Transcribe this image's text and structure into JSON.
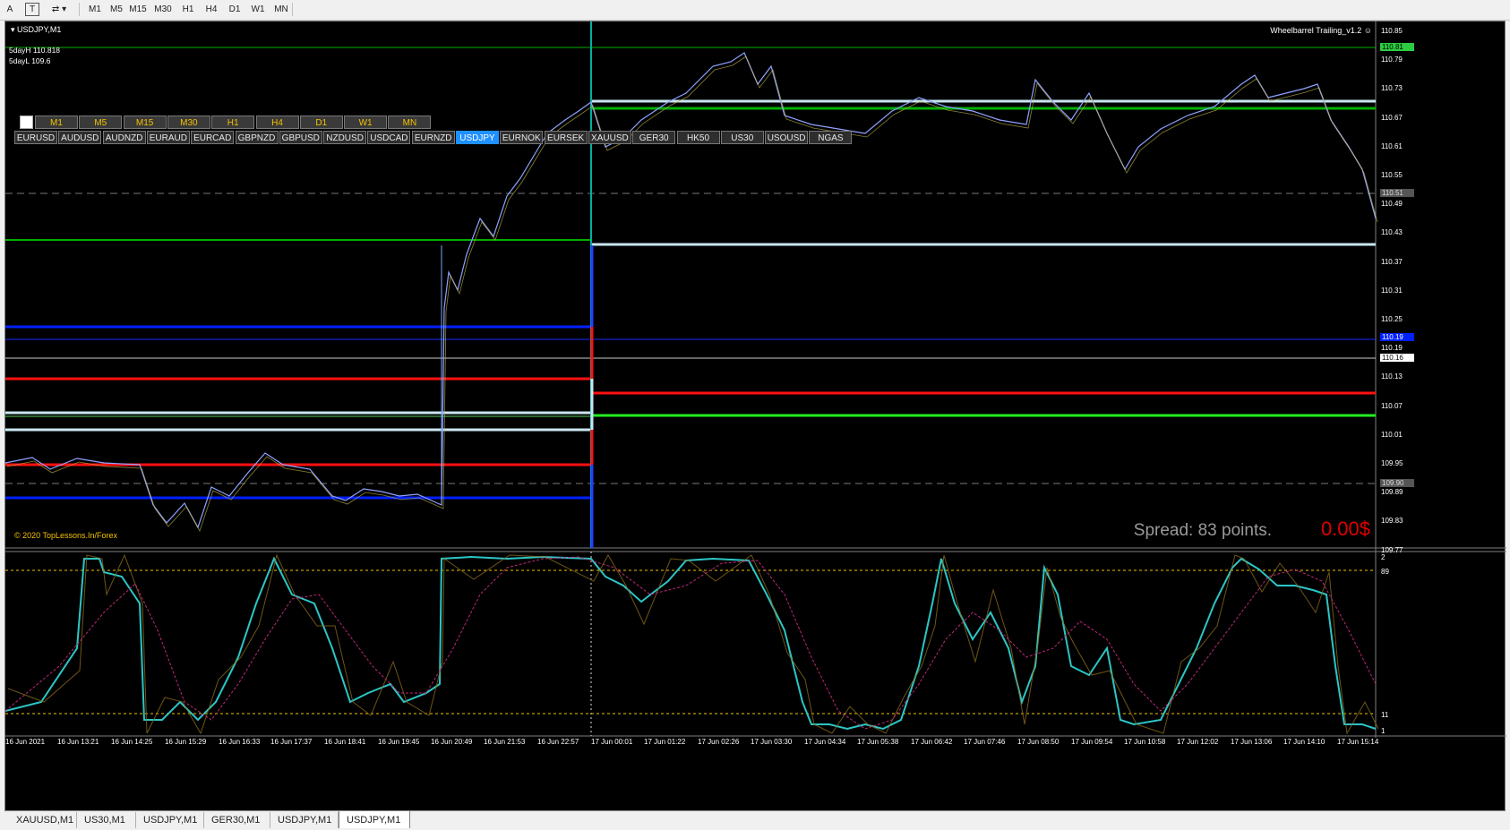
{
  "toolbar": {
    "text_tool": "A",
    "textlabel_tool": "T",
    "periods": [
      "M1",
      "M5",
      "M15",
      "M30",
      "H1",
      "H4",
      "D1",
      "W1",
      "MN"
    ]
  },
  "chart": {
    "title": "USDJPY,M1",
    "ea_name": "Wheelbarrel Trailing_v1.2",
    "five_day_high": "5dayH 110.818",
    "five_day_low": "5dayL 109.6",
    "spread": "Spread: 83 points.",
    "profit": "0.00$",
    "copyright": "© 2020 TopLessons.In/Forex"
  },
  "timeframe_buttons": [
    "M1",
    "M5",
    "M15",
    "M30",
    "H1",
    "H4",
    "D1",
    "W1",
    "MN"
  ],
  "selected_timeframe": "M1",
  "symbol_buttons": [
    "EURUSD",
    "AUDUSD",
    "AUDNZD",
    "EURAUD",
    "EURCAD",
    "GBPNZD",
    "GBPUSD",
    "NZDUSD",
    "USDCAD",
    "EURNZD",
    "USDJPY",
    "EURNOK",
    "EURSEK",
    "XAUUSD",
    "GER30",
    "HK50",
    "US30",
    "USOUSD",
    "NGAS"
  ],
  "selected_symbol": "USDJPY",
  "price_axis": [
    "110.85",
    "110.79",
    "110.73",
    "110.67",
    "110.61",
    "110.55",
    "110.49",
    "110.43",
    "110.37",
    "110.31",
    "110.25",
    "110.19",
    "110.13",
    "110.07",
    "110.01",
    "109.95",
    "109.89",
    "109.83",
    "109.77"
  ],
  "price_tags": {
    "top_green": "110.81",
    "gray_dashed": "110.51",
    "blue": "110.19",
    "white": "110.16",
    "lower_dashed": "109.90"
  },
  "indicator_axis": [
    "2",
    "89",
    "11",
    "1"
  ],
  "time_axis": [
    "16 Jun 2021",
    "16 Jun 13:21",
    "16 Jun 14:25",
    "16 Jun 15:29",
    "16 Jun 16:33",
    "16 Jun 17:37",
    "16 Jun 18:41",
    "16 Jun 19:45",
    "16 Jun 20:49",
    "16 Jun 21:53",
    "16 Jun 22:57",
    "17 Jun 00:01",
    "17 Jun 01:22",
    "17 Jun 02:26",
    "17 Jun 03:30",
    "17 Jun 04:34",
    "17 Jun 05:38",
    "17 Jun 06:42",
    "17 Jun 07:46",
    "17 Jun 08:50",
    "17 Jun 09:54",
    "17 Jun 10:58",
    "17 Jun 12:02",
    "17 Jun 13:06",
    "17 Jun 14:10",
    "17 Jun 15:14"
  ],
  "tabs": [
    "XAUUSD,M1",
    "US30,M1",
    "USDJPY,M1",
    "GER30,M1",
    "USDJPY,M1",
    "USDJPY,M1"
  ],
  "active_tab": 5,
  "colors": {
    "bg": "#000000",
    "green": "#00b000",
    "blue": "#0020ff",
    "red": "#ff1010",
    "white_line": "#c8e6f0",
    "cyan": "#2cc6c6",
    "magenta": "#c0287a",
    "yellow": "#f3c200"
  }
}
